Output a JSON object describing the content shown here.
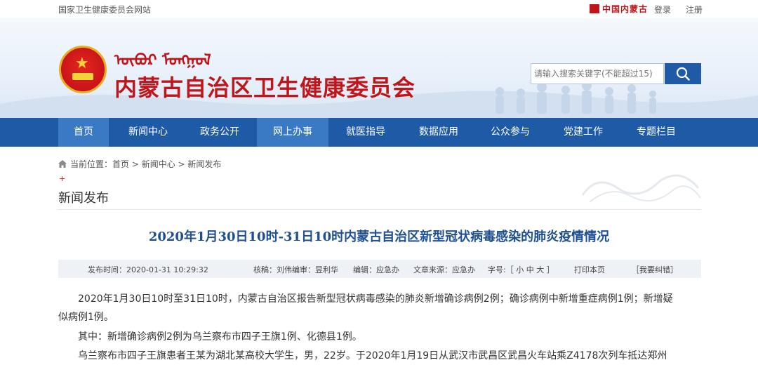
{
  "topbar": {
    "site_name": "国家卫生健康委员会网站",
    "partner_logo": "中国内蒙古",
    "login": "登录",
    "register": "注册"
  },
  "header": {
    "mongolian_title": "ᠥᠪᠦᠷ ᠮᠣᠩᠭᠣᠯ",
    "org_title": "内蒙古自治区卫生健康委员会",
    "search_placeholder": "请输入搜索关键字(不能超过15)",
    "search_icon": "search-icon"
  },
  "nav": {
    "items": [
      {
        "label": "首页"
      },
      {
        "label": "新闻中心"
      },
      {
        "label": "政务公开"
      },
      {
        "label": "网上办事"
      },
      {
        "label": "就医指导"
      },
      {
        "label": "数据应用"
      },
      {
        "label": "公众参与"
      },
      {
        "label": "党建工作"
      },
      {
        "label": "专题栏目"
      }
    ]
  },
  "breadcrumb": {
    "prefix": "当前位置：",
    "home": "首页",
    "sep1": " > ",
    "level1": "新闻中心",
    "sep2": " > ",
    "level2": "新闻发布"
  },
  "section": {
    "plus": "+",
    "title": "新闻发布"
  },
  "article": {
    "title": "2020年1月30日10时-31日10时内蒙古自治区新型冠状病毒感染的肺炎疫情情况",
    "meta": {
      "publish_time": "发布时间：2020-01-31 10:29:32",
      "verifier": "核稿：刘伟",
      "editor": "编审：昱利华",
      "compiler": "编辑：应急办",
      "source": "文章来源：应急办",
      "font_size": "字号:［ 小 中 大 ］",
      "print": "打印本页",
      "report_error": "［我要纠错］"
    },
    "paragraphs": [
      "2020年1月30日10时至31日10时，内蒙古自治区报告新型冠状病毒感染的肺炎新增确诊病例2例；确诊病例中新增重症病例1例；新增疑",
      "似病例1例。",
      "其中：新增确诊病例2例为乌兰察布市四子王旗1例、化德县1例。",
      "乌兰察布市四子王旗患者王某为湖北某高校大学生，男，22岁。于2020年1月19日从武汉市武昌区武昌火车站乘Z4178次列车抵达郑州"
    ]
  },
  "colors": {
    "brand_red": "#c0161b",
    "nav_blue": "#1e5aa6",
    "title_blue": "#1e4f93"
  }
}
